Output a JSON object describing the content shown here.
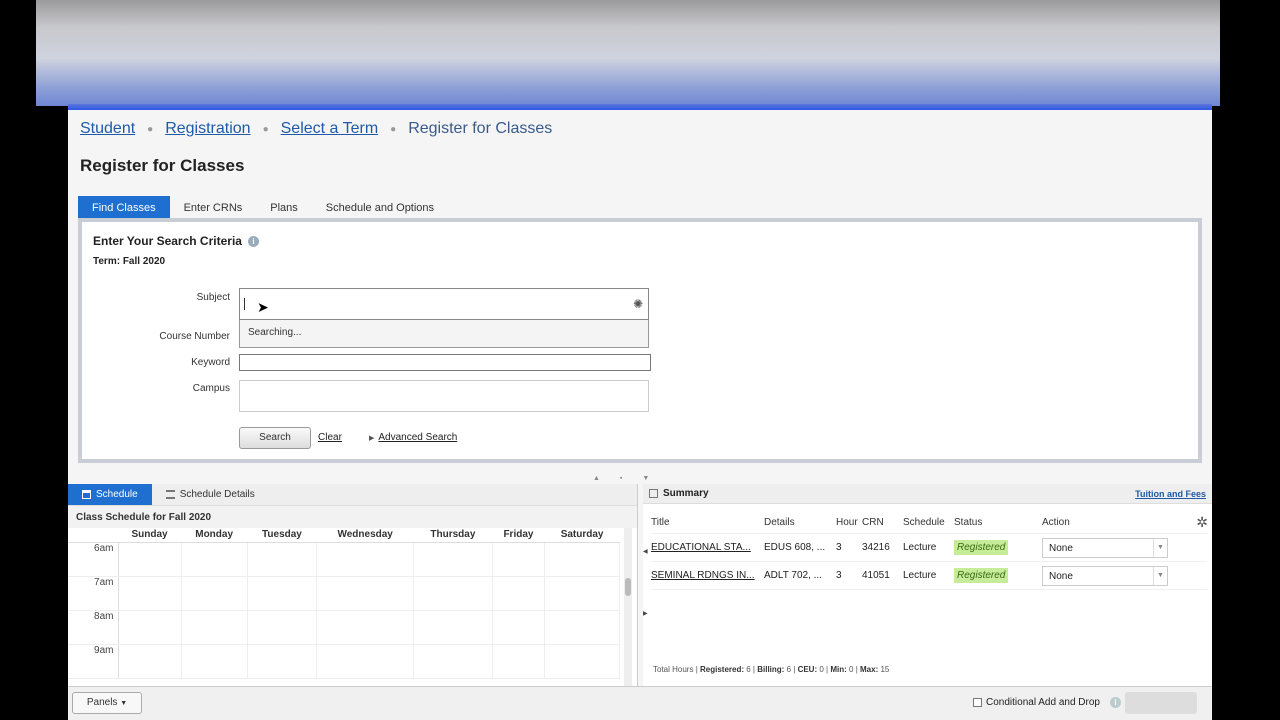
{
  "breadcrumb": {
    "student": "Student",
    "registration": "Registration",
    "select_term": "Select a Term",
    "current": "Register for Classes"
  },
  "page_title": "Register for Classes",
  "tabs": [
    "Find Classes",
    "Enter CRNs",
    "Plans",
    "Schedule and Options"
  ],
  "search": {
    "title": "Enter Your Search Criteria",
    "term": "Term: Fall 2020",
    "subject_label": "Subject",
    "course_number_label": "Course Number",
    "keyword_label": "Keyword",
    "campus_label": "Campus",
    "dropdown_text": "Searching...",
    "search_button": "Search",
    "clear_link": "Clear",
    "advanced_link": "Advanced Search"
  },
  "schedule": {
    "tab_schedule": "Schedule",
    "tab_details": "Schedule Details",
    "caption": "Class Schedule for Fall 2020",
    "days": [
      "Sunday",
      "Monday",
      "Tuesday",
      "Wednesday",
      "Thursday",
      "Friday",
      "Saturday"
    ],
    "times": [
      "6am",
      "7am",
      "8am",
      "9am"
    ]
  },
  "summary": {
    "title": "Summary",
    "tuition_link": "Tuition and Fees",
    "headers": {
      "title": "Title",
      "details": "Details",
      "hour": "Hour",
      "crn": "CRN",
      "schedule": "Schedule",
      "status": "Status",
      "action": "Action"
    },
    "rows": [
      {
        "title": "EDUCATIONAL STA...",
        "details": "EDUS 608, ...",
        "hour": "3",
        "crn": "34216",
        "schedule": "Lecture",
        "status": "Registered",
        "action": "None"
      },
      {
        "title": "SEMINAL RDNGS IN...",
        "details": "ADLT 702, ...",
        "hour": "3",
        "crn": "41051",
        "schedule": "Lecture",
        "status": "Registered",
        "action": "None"
      }
    ],
    "footer": {
      "total": "Total Hours",
      "registered_label": "Registered:",
      "registered": "6",
      "billing_label": "Billing:",
      "billing": "6",
      "ceu_label": "CEU:",
      "ceu": "0",
      "min_label": "Min:",
      "min": "0",
      "max_label": "Max:",
      "max": "15"
    }
  },
  "bottom": {
    "panels": "Panels",
    "conditional": "Conditional Add and Drop"
  },
  "icons": {
    "spinner": "loading-spinner-icon",
    "gear": "gear-icon",
    "info": "info-icon"
  },
  "colors": {
    "accent": "#1e6fd0",
    "registered_bg": "#c6ec9a",
    "link": "#1d5aa8"
  }
}
